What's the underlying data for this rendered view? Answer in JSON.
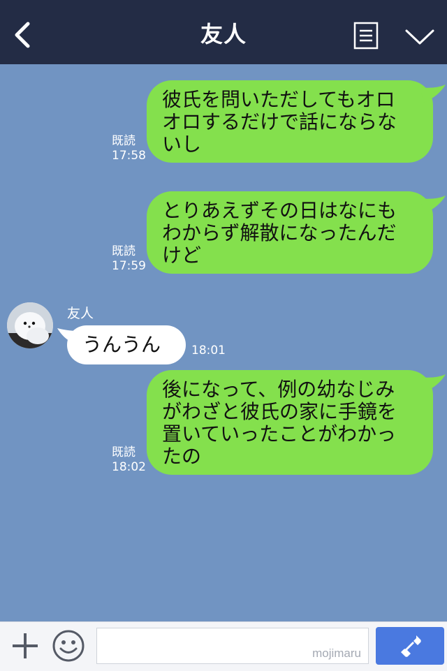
{
  "header": {
    "title": "友人",
    "back_icon": "chevron-left-icon",
    "notes_icon": "notes-icon",
    "menu_icon": "chevron-down-icon"
  },
  "messages": [
    {
      "side": "out",
      "text": "彼氏を問いただしてもオロオロするだけで話にならないし",
      "read": "既読",
      "time": "17:58"
    },
    {
      "side": "out",
      "text": "とりあえずその日はなにもわからず解散になったんだけど",
      "read": "既読",
      "time": "17:59"
    },
    {
      "side": "in",
      "sender": "友人",
      "text": "うんうん",
      "time": "18:01"
    },
    {
      "side": "out",
      "text": "後になって、例の幼なじみがわざと彼氏の家に手鏡を置いていったことがわかったの",
      "read": "既読",
      "time": "18:02"
    }
  ],
  "lines": {
    "m1": [
      "彼氏を問いただしてもオロ",
      "オロするだけで話にならな",
      "いし"
    ],
    "m2": [
      "とりあえずその日はなにも",
      "わからず解散になったんだ",
      "けど"
    ],
    "m4": [
      "後になって、例の幼なじみ",
      "がわざと彼氏の家に手鏡を",
      "置いていったことがわかっ",
      "たの"
    ]
  },
  "input_bar": {
    "value": "",
    "watermark": "mojimaru",
    "plus_icon": "plus-icon",
    "emoji_icon": "smiley-icon",
    "call_icon": "phone-icon"
  },
  "colors": {
    "header_bg": "#232c45",
    "chat_bg": "#7194c2",
    "outgoing_bubble": "#84e04d",
    "incoming_bubble": "#ffffff",
    "call_button": "#4a79e0"
  }
}
